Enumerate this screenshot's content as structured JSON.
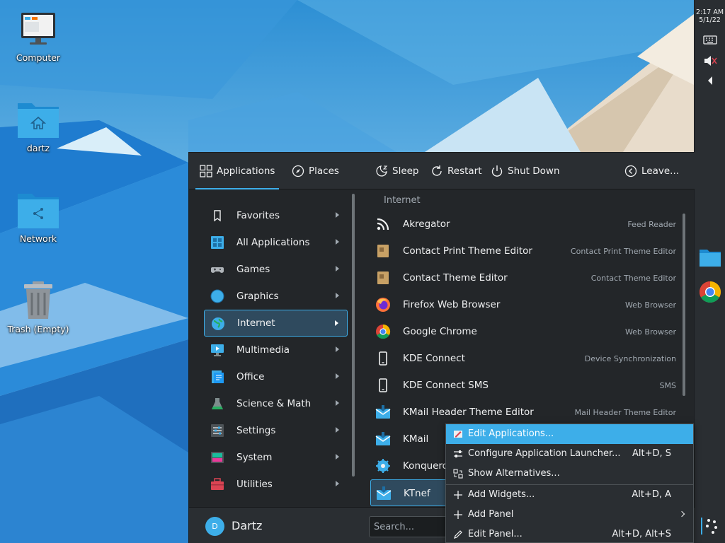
{
  "desktop": {
    "icons": [
      {
        "label": "Computer"
      },
      {
        "label": "dartz"
      },
      {
        "label": "Network"
      },
      {
        "label": "Trash (Empty)"
      }
    ]
  },
  "panel": {
    "time": "2:17 AM",
    "date": "5/1/22",
    "tray_icons": [
      "keyboard-icon",
      "speaker-muted-icon",
      "arrow-left-icon"
    ],
    "tasks": [
      "file-manager-icon",
      "chrome-icon"
    ],
    "launcher_icon": "kde-launcher-icon"
  },
  "launcher": {
    "tabs": [
      {
        "label": "Applications",
        "icon": "grid-icon",
        "active": true
      },
      {
        "label": "Places",
        "icon": "compass-icon",
        "active": false
      }
    ],
    "actions": [
      {
        "label": "Sleep",
        "icon": "sleep-icon"
      },
      {
        "label": "Restart",
        "icon": "restart-icon"
      },
      {
        "label": "Shut Down",
        "icon": "power-icon"
      },
      {
        "label": "Leave...",
        "icon": "leave-icon"
      }
    ],
    "categories": [
      {
        "label": "Favorites",
        "icon": "bookmark-icon"
      },
      {
        "label": "All Applications",
        "icon": "all-apps-icon"
      },
      {
        "label": "Games",
        "icon": "gamepad-icon"
      },
      {
        "label": "Graphics",
        "icon": "graphics-icon"
      },
      {
        "label": "Internet",
        "icon": "globe-icon",
        "selected": true
      },
      {
        "label": "Multimedia",
        "icon": "multimedia-icon"
      },
      {
        "label": "Office",
        "icon": "office-icon"
      },
      {
        "label": "Science & Math",
        "icon": "flask-icon"
      },
      {
        "label": "Settings",
        "icon": "settings-icon"
      },
      {
        "label": "System",
        "icon": "system-icon"
      },
      {
        "label": "Utilities",
        "icon": "toolbox-icon"
      }
    ],
    "section_title": "Internet",
    "apps": [
      {
        "name": "Akregator",
        "desc": "Feed Reader",
        "icon": "rss-icon"
      },
      {
        "name": "Contact Print Theme Editor",
        "desc": "Contact Print Theme Editor",
        "icon": "theme-editor-icon"
      },
      {
        "name": "Contact Theme Editor",
        "desc": "Contact Theme Editor",
        "icon": "theme-editor-icon"
      },
      {
        "name": "Firefox Web Browser",
        "desc": "Web Browser",
        "icon": "firefox-icon"
      },
      {
        "name": "Google Chrome",
        "desc": "Web Browser",
        "icon": "chrome-icon"
      },
      {
        "name": "KDE Connect",
        "desc": "Device Synchronization",
        "icon": "phone-icon"
      },
      {
        "name": "KDE Connect SMS",
        "desc": "SMS",
        "icon": "phone-icon"
      },
      {
        "name": "KMail Header Theme Editor",
        "desc": "Mail Header Theme Editor",
        "icon": "kmail-icon"
      },
      {
        "name": "KMail",
        "desc": "",
        "icon": "kmail-icon"
      },
      {
        "name": "Konquero",
        "desc": "",
        "icon": "konqueror-icon"
      },
      {
        "name": "KTnef",
        "desc": "",
        "icon": "kmail-icon",
        "selected": true
      }
    ],
    "user": {
      "initial": "D",
      "name": "Dartz"
    },
    "search": {
      "placeholder": "Search..."
    }
  },
  "context_menu": {
    "items": [
      {
        "label": "Edit Applications...",
        "shortcut": "",
        "icon": "edit-apps-icon",
        "highlight": true
      },
      {
        "label": "Configure Application Launcher...",
        "shortcut": "Alt+D, S",
        "icon": "configure-icon"
      },
      {
        "label": "Show Alternatives...",
        "shortcut": "",
        "icon": "alternatives-icon"
      },
      {
        "label": "Add Widgets...",
        "shortcut": "Alt+D, A",
        "icon": "plus-icon"
      },
      {
        "label": "Add Panel",
        "shortcut": "",
        "icon": "plus-icon",
        "submenu": true
      },
      {
        "label": "Edit Panel...",
        "shortcut": "Alt+D, Alt+S",
        "icon": "pencil-icon"
      }
    ]
  },
  "colors": {
    "accent": "#3daee9",
    "background": "#232629",
    "panel": "#2a2e32",
    "text": "#eff0f1",
    "subtext": "#a1a9b1"
  }
}
